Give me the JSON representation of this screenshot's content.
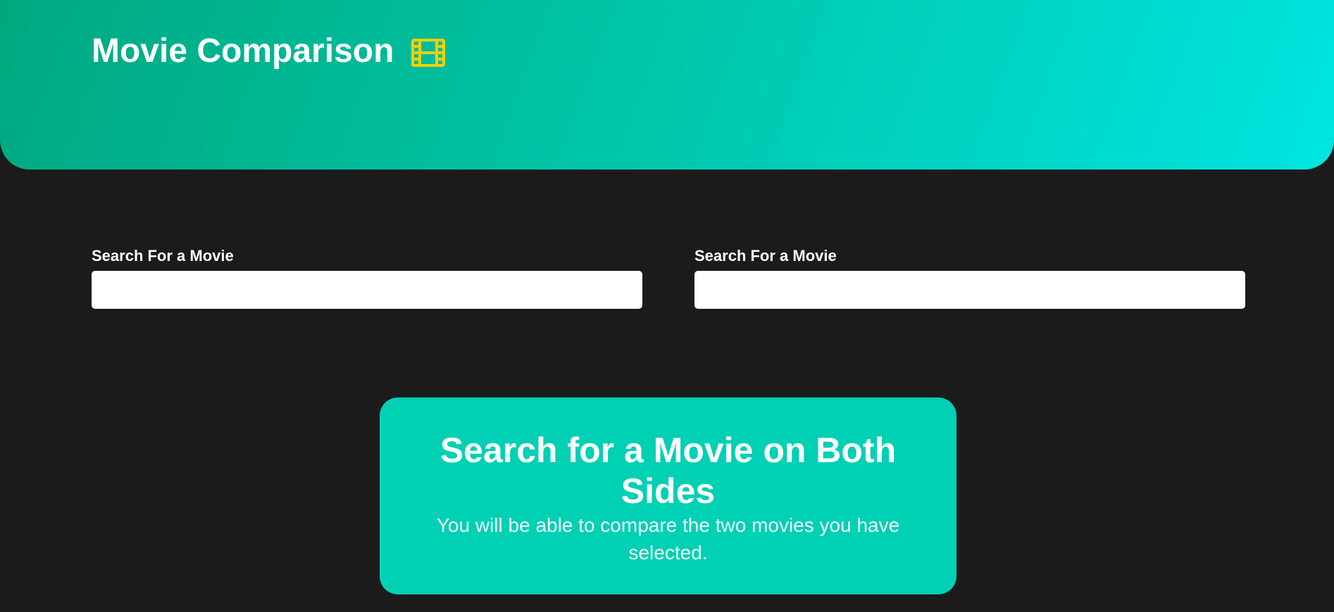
{
  "header": {
    "title": "Movie Comparison",
    "icon": "film-icon",
    "gradient_start": "#00a87f",
    "gradient_end": "#00e5e1",
    "icon_color": "#f5d000"
  },
  "search": {
    "left": {
      "label": "Search For a Movie",
      "value": "",
      "placeholder": ""
    },
    "right": {
      "label": "Search For a Movie",
      "value": "",
      "placeholder": ""
    }
  },
  "prompt": {
    "heading": "Search for a Movie on Both Sides",
    "text": "You will be able to compare the two movies you have selected.",
    "background": "#00d0b4"
  },
  "page": {
    "background": "#1b1b1b"
  }
}
